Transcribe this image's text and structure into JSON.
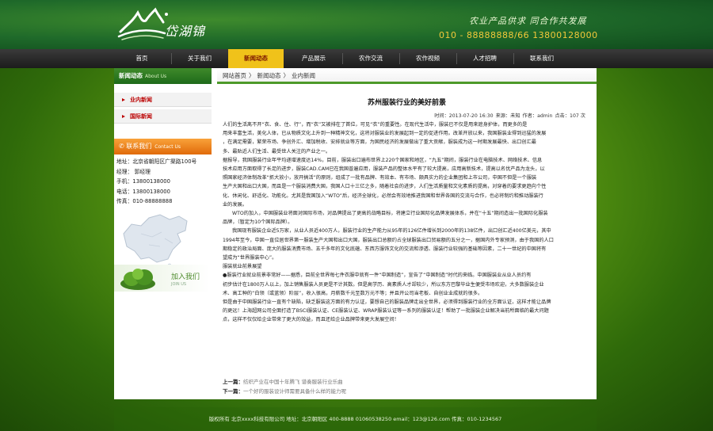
{
  "header": {
    "logo_text": "岱湖锦",
    "slogan": "农业产品供求  同合作共发展",
    "phones": "010 - 88888888/66   13800128000"
  },
  "nav": {
    "items": [
      {
        "label": "首页"
      },
      {
        "label": "关于我们"
      },
      {
        "label": "新闻动态",
        "active": true
      },
      {
        "label": "产品展示"
      },
      {
        "label": "农作交流"
      },
      {
        "label": "农作视频"
      },
      {
        "label": "人才招聘"
      },
      {
        "label": "联系我们"
      }
    ]
  },
  "sidebar": {
    "news_title": "新闻动态",
    "news_title_en": "About Us",
    "sub_items": [
      {
        "label": "业内新闻"
      },
      {
        "label": "国际新闻"
      }
    ],
    "contact_title": "联系我们",
    "contact_title_en": "Contact Us",
    "contact_lines": [
      "地址：北京省朝阳区广渠路100号",
      "经理：  郭经理",
      "手机：13800138000",
      "电话：13800138000",
      "传真：010-88888888"
    ],
    "join_label": "加入我们",
    "join_en": "JOIN US"
  },
  "breadcrumb": {
    "home": "网站首页",
    "section": "新闻动态",
    "current": "业内新闻",
    "sep": "〉"
  },
  "article": {
    "title": "苏州服装行业的美好前景",
    "meta": {
      "time": "时间：2013-07-20 16:30",
      "source": "来源：未知",
      "author": "作者：admin",
      "clicks": "点击：107 次"
    },
    "paragraphs": [
      {
        "indent": false,
        "text": "人们的生活离不开“衣、食、住、行”，而“衣”又被排在了首位，可见“衣”的重要性。在现代生活中，服装已不仅是用来遮身护体，而更多的是"
      },
      {
        "indent": false,
        "text": "用来丰富生活，美化人体，已从物质文化上升到一种精神文化，这将对服装业的发展起到一定的促进作用。改革开放以来，我国服装业得到迅猛的发展"
      },
      {
        "indent": false,
        "text": "，在满足需要，繁荣市场、争创外汇、增加税收、安排就业等方面，为国民经济的发展做出了重大贡献，服装成为这一时期发展最快、出口创汇最"
      },
      {
        "indent": false,
        "text": "多、最贴近人们生活、最受世人关注的产业之一。"
      },
      {
        "indent": false,
        "text": "据报导，我国服装行业年平均递增速度达14%，目前，服装出口遍布世界上220个国家和地区，“九五”期间，服装行业在电脑技术、网络技术、信息"
      },
      {
        "indent": false,
        "text": "技术应用方面取得了长足的进步，服装CAD.CAM已在我国普遍应用，服装产品的整体水平有了较大提高，应用高新技术，提高以名优产品为龙头，以"
      },
      {
        "indent": false,
        "text": "照国家经济体制改革“抓大放小，放开搞活”的原则，组成了一批有品牌、有效本、有市场、颇具实力的企业集团和上市公司，中国不但是一个服装"
      },
      {
        "indent": false,
        "text": "生产大国和出口大国，而且是一个服装消费大国，我国人口十三亿之多，随着社会的进步，人们生活质量和文化素质的提高，对穿着的要求更趋向个性"
      },
      {
        "indent": false,
        "text": "化、休闲化、舒适化、功能化。尤其是我国加入“WTO”后，经济全球化，必然会有效地推进我国和世界各国的交流与合作，也必将制约和推动服装行"
      },
      {
        "indent": false,
        "text": "业的发展。"
      },
      {
        "indent": true,
        "text": "WTO的加入，中国服装业将面对国际市场，对品牌提出了更高的战略目标，将建立行业国际化品牌发展体系，并在“十五”期间造出一批国际化服装"
      },
      {
        "indent": false,
        "text": "品牌，（暂定为10个国际品牌）。"
      },
      {
        "indent": true,
        "text": "我国现有服装企业近5万家，从业人员近400万人，服装行业的生产能力从95年的126亿件增长到2000年的138亿件，出口创汇近400亿美元，其中"
      },
      {
        "indent": false,
        "text": "1994年至今，中国一直位居世界第一服装生产大国和出口大国，服装出口总额约占全球服装出口贸易额的五分之一，据国内外专家预测，由于我国的人口"
      },
      {
        "indent": false,
        "text": "期稳定的政治局面、庞大的服装消费市场、五千多年的文化底蕴、东西方服饰文化的交流和渗透、服装行业较强的基础等因素，二十一世纪的中国将有"
      },
      {
        "indent": false,
        "text": "望成为“世界服装中心”。"
      },
      {
        "indent": false,
        "text": "服装就业前景展望"
      },
      {
        "indent": false,
        "text": "●服装行业就业前景非常好——据悉，目前全世界每七件衣服中就有一件“中国制造”，宣告了“中国制造”时代的来临。中国服装业从业人员约有"
      },
      {
        "indent": false,
        "text": "初步估计在1800万人以上，加上销售服装人员更是不计其数。但是高学历、高素质人才却较少，所以东方巴黎毕业生便受市场欢迎，大多数服装企业"
      },
      {
        "indent": false,
        "text": "术、高工种的“白领（或蓝领）阶层”，收入很高，月薪数千元至数万元不等；并且开公司当老板、自创业业成就的很多。"
      },
      {
        "indent": false,
        "text": "但是由于中国服装行业一直有个缺陷，缺乏服装这方面的有力认证，要想自己的服装品牌走出全世界，必须得到服装行业的全方面认证，这样才能让品牌"
      },
      {
        "indent": false,
        "text": "的更远！上海超网公司全面打造了BSCI服装认证、CE服装认证、WRAP服装认证等一系列的服装认证！帮助了一批服装企业解决当前所面临的最大问题"
      },
      {
        "indent": false,
        "text": "点，这样不仅仅给企业带来了更大的效益，而且还给企业品牌带来更大发展空间！"
      }
    ],
    "prev_label": "上一篇：",
    "prev_text": "纺织产业在中国十年腾飞 谱奏服装行业乐曲",
    "next_label": "下一篇：",
    "next_text": "一个好的服装设计师需要具备什么样的能力呢"
  },
  "footer": {
    "text": "版权所有 北京xxxx科技有限公司 地址：北京朝阳区 400-8888 01060538250 email：123@126.com 传真：010-1234567"
  }
}
